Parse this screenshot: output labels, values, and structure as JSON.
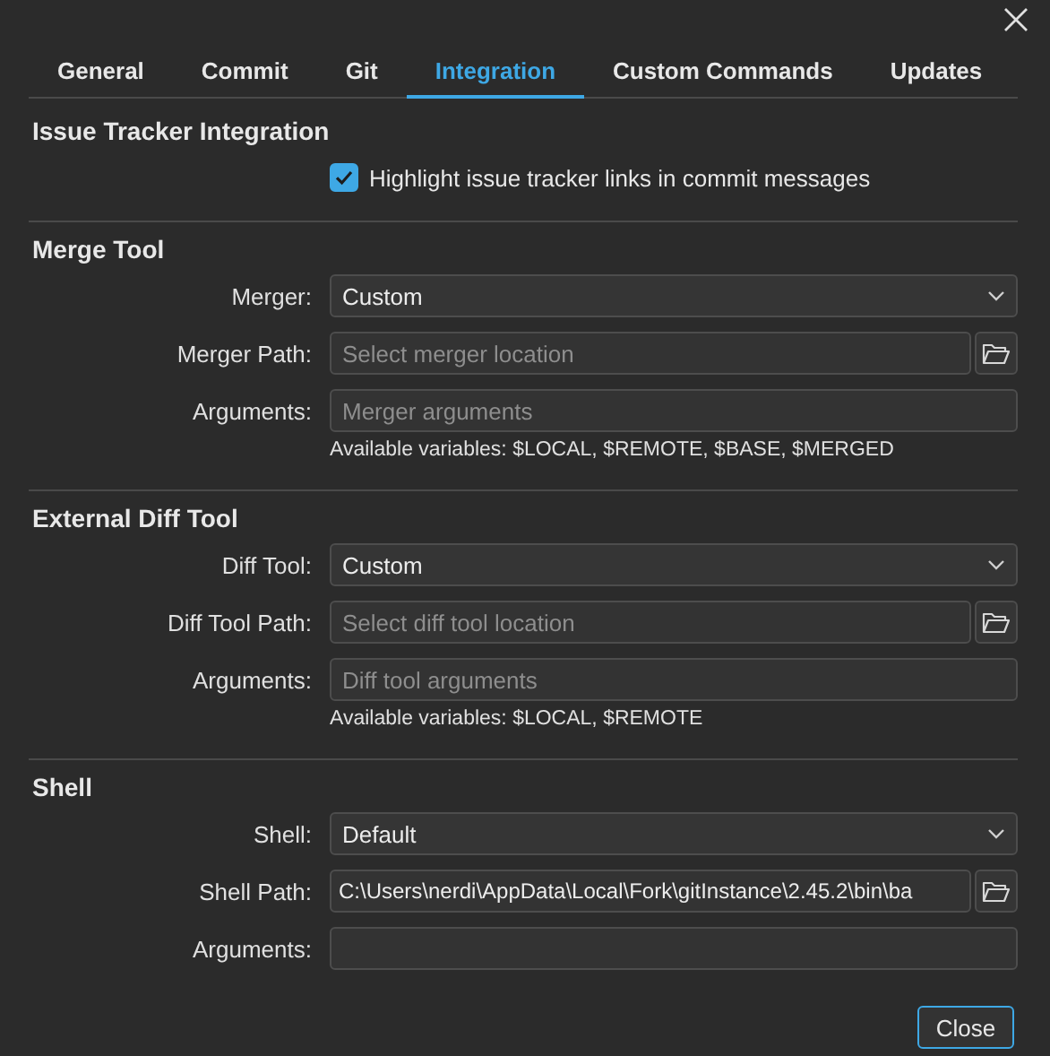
{
  "tabs": [
    {
      "label": "General",
      "selected": false
    },
    {
      "label": "Commit",
      "selected": false
    },
    {
      "label": "Git",
      "selected": false
    },
    {
      "label": "Integration",
      "selected": true
    },
    {
      "label": "Custom Commands",
      "selected": false
    },
    {
      "label": "Updates",
      "selected": false
    }
  ],
  "sections": [
    {
      "title": "Issue Tracker Integration",
      "rows": [
        {
          "kind": "checkbox",
          "text": "Highlight issue tracker links in commit messages",
          "checked": true
        }
      ]
    },
    {
      "title": "Merge Tool",
      "rows": [
        {
          "kind": "select",
          "label": "Merger:",
          "value": "Custom"
        },
        {
          "kind": "path",
          "label": "Merger Path:",
          "placeholder": "Select merger location"
        },
        {
          "kind": "text",
          "label": "Arguments:",
          "placeholder": "Merger arguments"
        },
        {
          "kind": "hint",
          "text": "Available variables: $LOCAL, $REMOTE, $BASE, $MERGED"
        }
      ]
    },
    {
      "title": "External Diff Tool",
      "rows": [
        {
          "kind": "select",
          "label": "Diff Tool:",
          "value": "Custom"
        },
        {
          "kind": "path",
          "label": "Diff Tool Path:",
          "placeholder": "Select diff tool location"
        },
        {
          "kind": "text",
          "label": "Arguments:",
          "placeholder": "Diff tool arguments"
        },
        {
          "kind": "hint",
          "text": "Available variables: $LOCAL, $REMOTE"
        }
      ]
    },
    {
      "title": "Shell",
      "rows": [
        {
          "kind": "select",
          "label": "Shell:",
          "value": "Default"
        },
        {
          "kind": "path",
          "label": "Shell Path:",
          "value": "C:\\Users\\nerdi\\AppData\\Local\\Fork\\gitInstance\\2.45.2\\bin\\ba"
        },
        {
          "kind": "text",
          "label": "Arguments:"
        }
      ]
    }
  ],
  "close_button": "Close"
}
